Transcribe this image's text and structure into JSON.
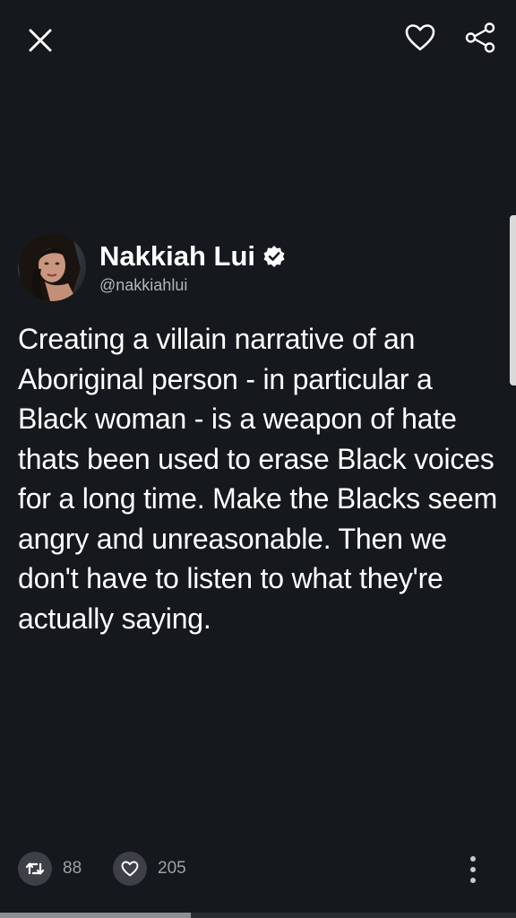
{
  "tweet": {
    "author_name": "Nakkiah Lui",
    "handle": "@nakkiahlui",
    "verified": true,
    "text": "Creating a villain narrative of an Aboriginal person - in particular a Black woman - is a weapon of hate thats been used to erase Black voices for a long time. Make the Blacks seem angry and unreasonable. Then we don't have to listen to what they're actually saying."
  },
  "actions": {
    "retweet_count": "88",
    "like_count": "205"
  },
  "icons": {
    "close": "close-icon",
    "like_top": "heart-outline-icon",
    "share": "share-icon",
    "verified": "verified-badge-icon",
    "retweet": "retweet-icon",
    "like": "heart-icon",
    "more": "more-vertical-icon"
  },
  "colors": {
    "background": "#15181c",
    "text": "#ffffff",
    "secondary_text": "#b3b6ba",
    "action_circle": "#3d4046"
  },
  "progress": {
    "fraction": 0.37
  }
}
